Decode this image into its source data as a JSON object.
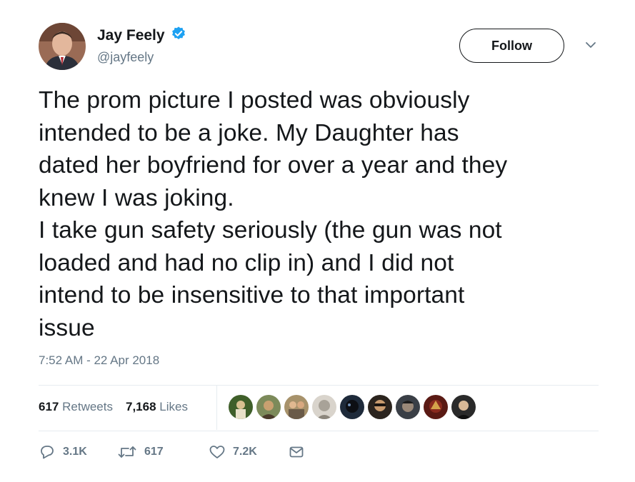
{
  "author": {
    "name": "Jay Feely",
    "handle": "@jayfeely",
    "verified": true,
    "verified_color": "#1da1f2"
  },
  "follow_label": "Follow",
  "tweet": {
    "text": "The prom picture I posted was obviously\nintended to be a joke. My Daughter has\ndated her boyfriend for over a year and they\nknew I was joking.\nI take gun safety seriously (the gun was not\nloaded and had no clip in) and I did not\nintend to be insensitive to that important\nissue",
    "timestamp": "7:52 AM - 22 Apr 2018"
  },
  "stats": {
    "retweets_count": "617",
    "retweets_label": "Retweets",
    "likes_count": "7,168",
    "likes_label": "Likes"
  },
  "liker_avatars": [
    {
      "name": "liker-avatar-1"
    },
    {
      "name": "liker-avatar-2"
    },
    {
      "name": "liker-avatar-3"
    },
    {
      "name": "liker-avatar-4"
    },
    {
      "name": "liker-avatar-5"
    },
    {
      "name": "liker-avatar-6"
    },
    {
      "name": "liker-avatar-7"
    },
    {
      "name": "liker-avatar-8"
    },
    {
      "name": "liker-avatar-9"
    }
  ],
  "actions": {
    "reply_icon": "reply-icon",
    "reply_count": "3.1K",
    "retweet_icon": "retweet-icon",
    "retweet_count": "617",
    "like_icon": "heart-icon",
    "like_count": "7.2K",
    "dm_icon": "envelope-icon"
  },
  "colors": {
    "text": "#14171a",
    "secondary": "#657786",
    "divider": "#e6ecf0"
  }
}
